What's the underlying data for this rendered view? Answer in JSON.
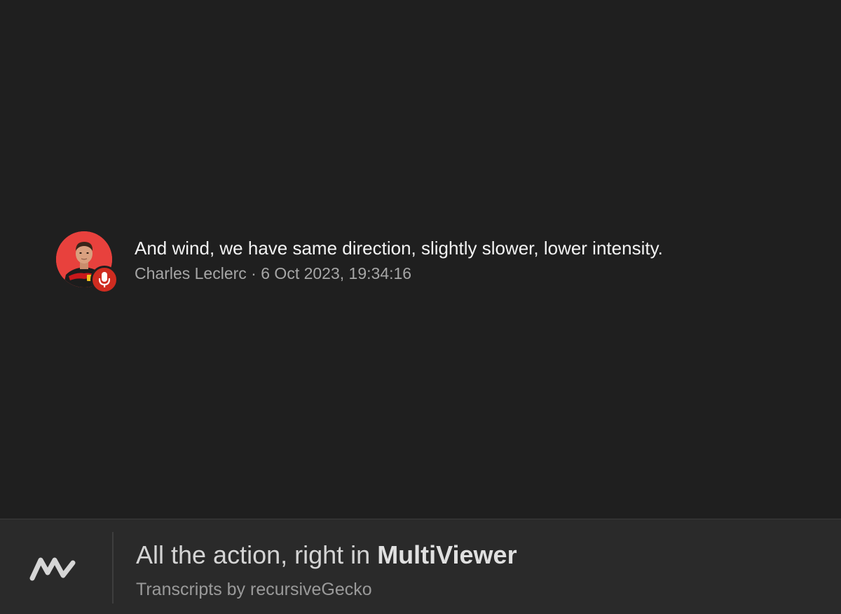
{
  "message": {
    "avatar_icon": "driver-avatar-icon",
    "badge_icon": "microphone-icon",
    "text": "And wind, we have same direction, slightly slower, lower intensity.",
    "driver": "Charles Leclerc",
    "separator": " · ",
    "timestamp": "6 Oct 2023, 19:34:16"
  },
  "footer": {
    "logo_icon": "multiviewer-logo-icon",
    "title_prefix": "All the action, right in ",
    "title_brand": "MultiViewer",
    "subtitle": "Transcripts by recursiveGecko"
  },
  "colors": {
    "background": "#1f1f1f",
    "footer_background": "#2a2a2a",
    "accent_red": "#cf2c20",
    "avatar_red": "#e8413d",
    "text_primary": "#f3f3f3",
    "text_secondary": "#a6a6a6"
  }
}
